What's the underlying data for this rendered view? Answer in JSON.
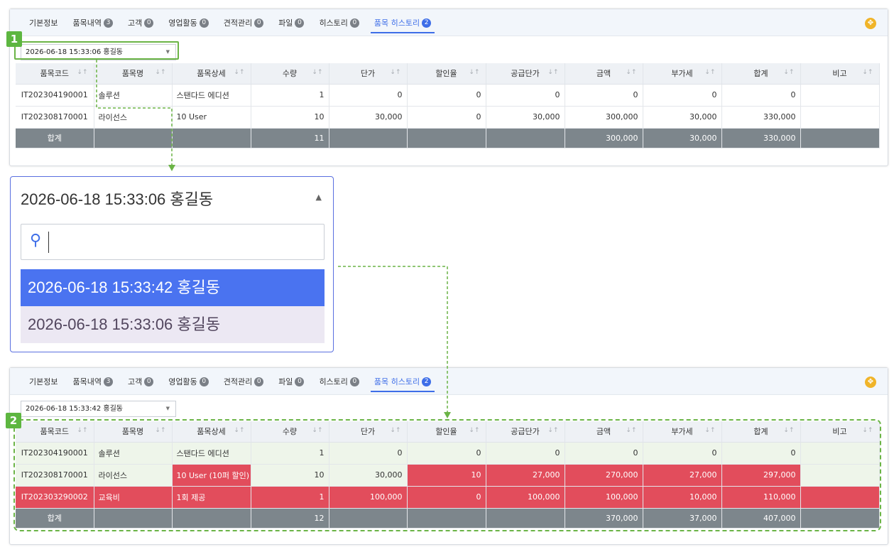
{
  "tabs": [
    {
      "label": "기본정보",
      "count": ""
    },
    {
      "label": "품목내역",
      "count": "3"
    },
    {
      "label": "고객",
      "count": "0"
    },
    {
      "label": "영업활동",
      "count": "0"
    },
    {
      "label": "견적관리",
      "count": "0"
    },
    {
      "label": "파일",
      "count": "0"
    },
    {
      "label": "히스토리",
      "count": "0"
    },
    {
      "label": "품목 히스토리",
      "count": "2"
    }
  ],
  "columns": [
    "품목코드",
    "품목명",
    "품목상세",
    "수량",
    "단가",
    "할인율",
    "공급단가",
    "금액",
    "부가세",
    "합계",
    "비고"
  ],
  "badges": {
    "one": "1",
    "two": "2"
  },
  "panel1": {
    "select_value": "2026-06-18 15:33:06 홍길동",
    "rows": [
      [
        "IT202304190001",
        "솔루션",
        "스탠다드 에디션",
        "1",
        "0",
        "0",
        "0",
        "0",
        "0",
        "0",
        ""
      ],
      [
        "IT202308170001",
        "라이선스",
        "10 User",
        "10",
        "30,000",
        "0",
        "30,000",
        "300,000",
        "30,000",
        "330,000",
        ""
      ]
    ],
    "sum": [
      "합계",
      "",
      "",
      "11",
      "",
      "",
      "",
      "300,000",
      "30,000",
      "330,000",
      ""
    ]
  },
  "popup": {
    "header": "2026-06-18 15:33:06 홍길동",
    "search_placeholder": "",
    "options": [
      "2026-06-18 15:33:42 홍길동",
      "2026-06-18 15:33:06 홍길동"
    ]
  },
  "panel2": {
    "select_value": "2026-06-18 15:33:42 홍길동",
    "rows": [
      [
        "IT202304190001",
        "솔루션",
        "스탠다드 에디션",
        "1",
        "0",
        "0",
        "0",
        "0",
        "0",
        "0",
        ""
      ],
      [
        "IT202308170001",
        "라이선스",
        "10 User (10퍼 할인)",
        "10",
        "30,000",
        "10",
        "27,000",
        "270,000",
        "27,000",
        "297,000",
        ""
      ],
      [
        "IT202303290002",
        "교육비",
        "1회 제공",
        "1",
        "100,000",
        "0",
        "100,000",
        "100,000",
        "10,000",
        "110,000",
        ""
      ]
    ],
    "sum": [
      "합계",
      "",
      "",
      "12",
      "",
      "",
      "",
      "370,000",
      "37,000",
      "407,000",
      ""
    ]
  },
  "colors": {
    "accent": "#3e6ee8",
    "highlight_green": "#6bb446",
    "changed_red": "#e24d5c",
    "sum_gray": "#7d868c"
  }
}
